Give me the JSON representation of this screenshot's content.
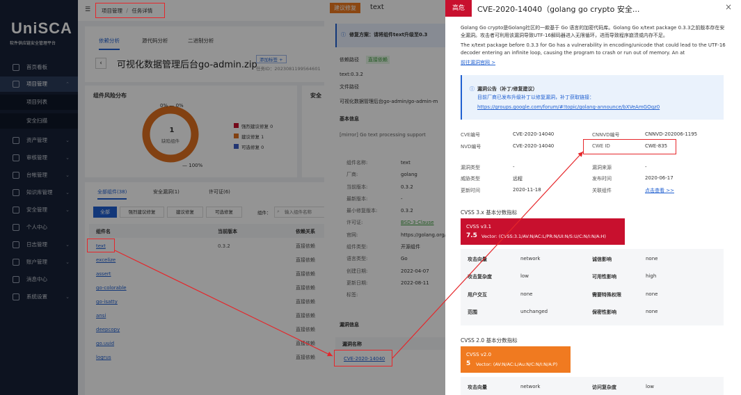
{
  "sidebar": {
    "logo": "UniSCA",
    "subtitle": "软件供应链安全管理平台",
    "items": [
      {
        "label": "首页看板"
      },
      {
        "label": "项目管理"
      },
      {
        "label": "项目列表"
      },
      {
        "label": "安全扫描"
      },
      {
        "label": "资产管理"
      },
      {
        "label": "审核管理"
      },
      {
        "label": "台帐管理"
      },
      {
        "label": "知识库管理"
      },
      {
        "label": "安全管理"
      },
      {
        "label": "个人中心"
      },
      {
        "label": "日志管理"
      },
      {
        "label": "账户管理"
      },
      {
        "label": "消息中心"
      },
      {
        "label": "系统设置"
      }
    ]
  },
  "header": {
    "breadcrumb_1": "项目管理",
    "breadcrumb_sep": "/",
    "breadcrumb_2": "任务详情"
  },
  "tabs": [
    "依赖分析",
    "源代码分析",
    "二进制分析"
  ],
  "project": {
    "name": "可视化数据管理后台go-admin.zip",
    "tag_button": "添加标签 +",
    "task_id": "任务ID：2023081199564601"
  },
  "risk": {
    "title": "组件风险分布",
    "top_label_a": "0%",
    "top_label_b": "0%",
    "center_value": "1",
    "center_label": "缺陷组件",
    "bottom_label": "100%",
    "legend": [
      "强烈建议修复 0",
      "建议修复 1",
      "可选修复 0"
    ],
    "colors": {
      "strong": "#c8102e",
      "suggest": "#e07020",
      "optional": "#3b5cc4"
    },
    "safe_title": "安全"
  },
  "comp_tabs": [
    "全部组件(38)",
    "安全漏洞(1)",
    "许可证(6)"
  ],
  "filters": [
    "全部",
    "强烈建议修复",
    "建议修复",
    "可选修复"
  ],
  "filter_label": "组件：",
  "search_placeholder": "输入组件名称",
  "table": {
    "headers": [
      "组件名",
      "当前版本",
      "依赖关系"
    ],
    "rows": [
      [
        "text",
        "0.3.2",
        "直接依赖"
      ],
      [
        "excelize",
        "",
        "直接依赖"
      ],
      [
        "assert",
        "",
        "直接依赖"
      ],
      [
        "go-colorable",
        "",
        "直接依赖"
      ],
      [
        "go-isatty",
        "",
        "直接依赖"
      ],
      [
        "ansi",
        "",
        "直接依赖"
      ],
      [
        "deepcopy",
        "",
        "直接依赖"
      ],
      [
        "go.uuid",
        "",
        "直接依赖"
      ],
      [
        "logrus",
        "",
        "直接依赖"
      ]
    ]
  },
  "drawer": {
    "tag": "建议修复",
    "title": "text",
    "fix_tip": "修复方案：请将组件text升级至0.3",
    "dep_path_label": "依赖路径",
    "dep_path_tag": "直接依赖",
    "dep_value": "text:0.3.2",
    "file_path_label": "文件路径",
    "file_path": "可视化数据管理后台go-admin/go-admin-m",
    "basic_info": "基本信息",
    "desc": "[mirror] Go text processing support",
    "fields": [
      [
        "组件名称:",
        "text"
      ],
      [
        "厂商:",
        "golang"
      ],
      [
        "当前版本:",
        "0.3.2"
      ],
      [
        "最新版本:",
        "-"
      ],
      [
        "最小修复版本:",
        "0.3.2"
      ],
      [
        "许可证:",
        "BSD-3-Clause"
      ],
      [
        "官网:",
        "https://golang.org/"
      ],
      [
        "组件类型:",
        "开源组件"
      ],
      [
        "语言类型:",
        "Go"
      ],
      [
        "创建日期:",
        "2022-04-07"
      ],
      [
        "更新日期:",
        "2022-08-11"
      ],
      [
        "标签:",
        ""
      ]
    ],
    "vuln_info": "漏洞信息",
    "vuln_col": "漏洞名称",
    "vuln_id": "CVE-2020-14040"
  },
  "panel": {
    "level": "高危",
    "title": "CVE-2020-14040（golang go crypto 安全...",
    "close": "×",
    "desc_cn": "Golang Go crypto是Golang社区的一款基于 Go 语言的加密代码库。Golang Go x/text package 0.3.3之前版本存在安全漏洞。攻击者可利用该漏洞导致UTF-16解码器进入无限循环，进而导致程序崩溃或内存不足。",
    "desc_en": "The x/text package before 0.3.3 for Go has a vulnerability in encoding/unicode that could lead to the UTF-16 decoder entering an infinite loop, causing the program to crash or run out of memory. An at",
    "official_link": "前往漏洞官网 >",
    "notice_title": "漏洞公告（补丁/修复建议）",
    "notice_text": "目前厂商已发布升级补丁以修复漏洞，补丁获取链接：",
    "notice_link": "https://groups.google.com/forum/#!topic/golang-announce/bXVeAmGOqz0",
    "info": [
      [
        "CVE编号",
        "CVE-2020-14040",
        "CNNVD编号",
        "CNNVD-202006-1195"
      ],
      [
        "NVD编号",
        "CVE-2020-14040",
        "CWE ID",
        "CWE-835"
      ],
      [
        "漏洞类型",
        "-",
        "漏洞来源",
        "-"
      ],
      [
        "威胁类型",
        "远程",
        "发布时间",
        "2020-06-17"
      ],
      [
        "更新时间",
        "2020-11-18",
        "关联组件",
        "点击查看 >>"
      ]
    ],
    "cvss3_title": "CVSS 3.x 基本分数指标",
    "cvss3_name": "CVSS v3.1",
    "cvss3_score": "7.5",
    "cvss3_vector": "Vector: (CVSS:3.1/AV:N/AC:L/PR:N/UI:N/S:U/C:N/I:N/A:H)",
    "cvss3_rows": [
      [
        "攻击向量",
        "network",
        "诚信影响",
        "none"
      ],
      [
        "攻击复杂度",
        "low",
        "可用性影响",
        "high"
      ],
      [
        "用户交互",
        "none",
        "需要特殊权限",
        "none"
      ],
      [
        "范围",
        "unchanged",
        "保密性影响",
        "none"
      ]
    ],
    "cvss2_title": "CVSS 2.0 基本分数指标",
    "cvss2_name": "CVSS v2.0",
    "cvss2_score": "5",
    "cvss2_vector": "Vector: (AV:N/AC:L/Au:N/C:N/I:N/A:P)",
    "cvss2_row": [
      "攻击向量",
      "network",
      "访问复杂度",
      "low"
    ],
    "colors": {
      "high": "#c8102e",
      "medium": "#f07a20",
      "link": "#1f5fd0"
    }
  }
}
